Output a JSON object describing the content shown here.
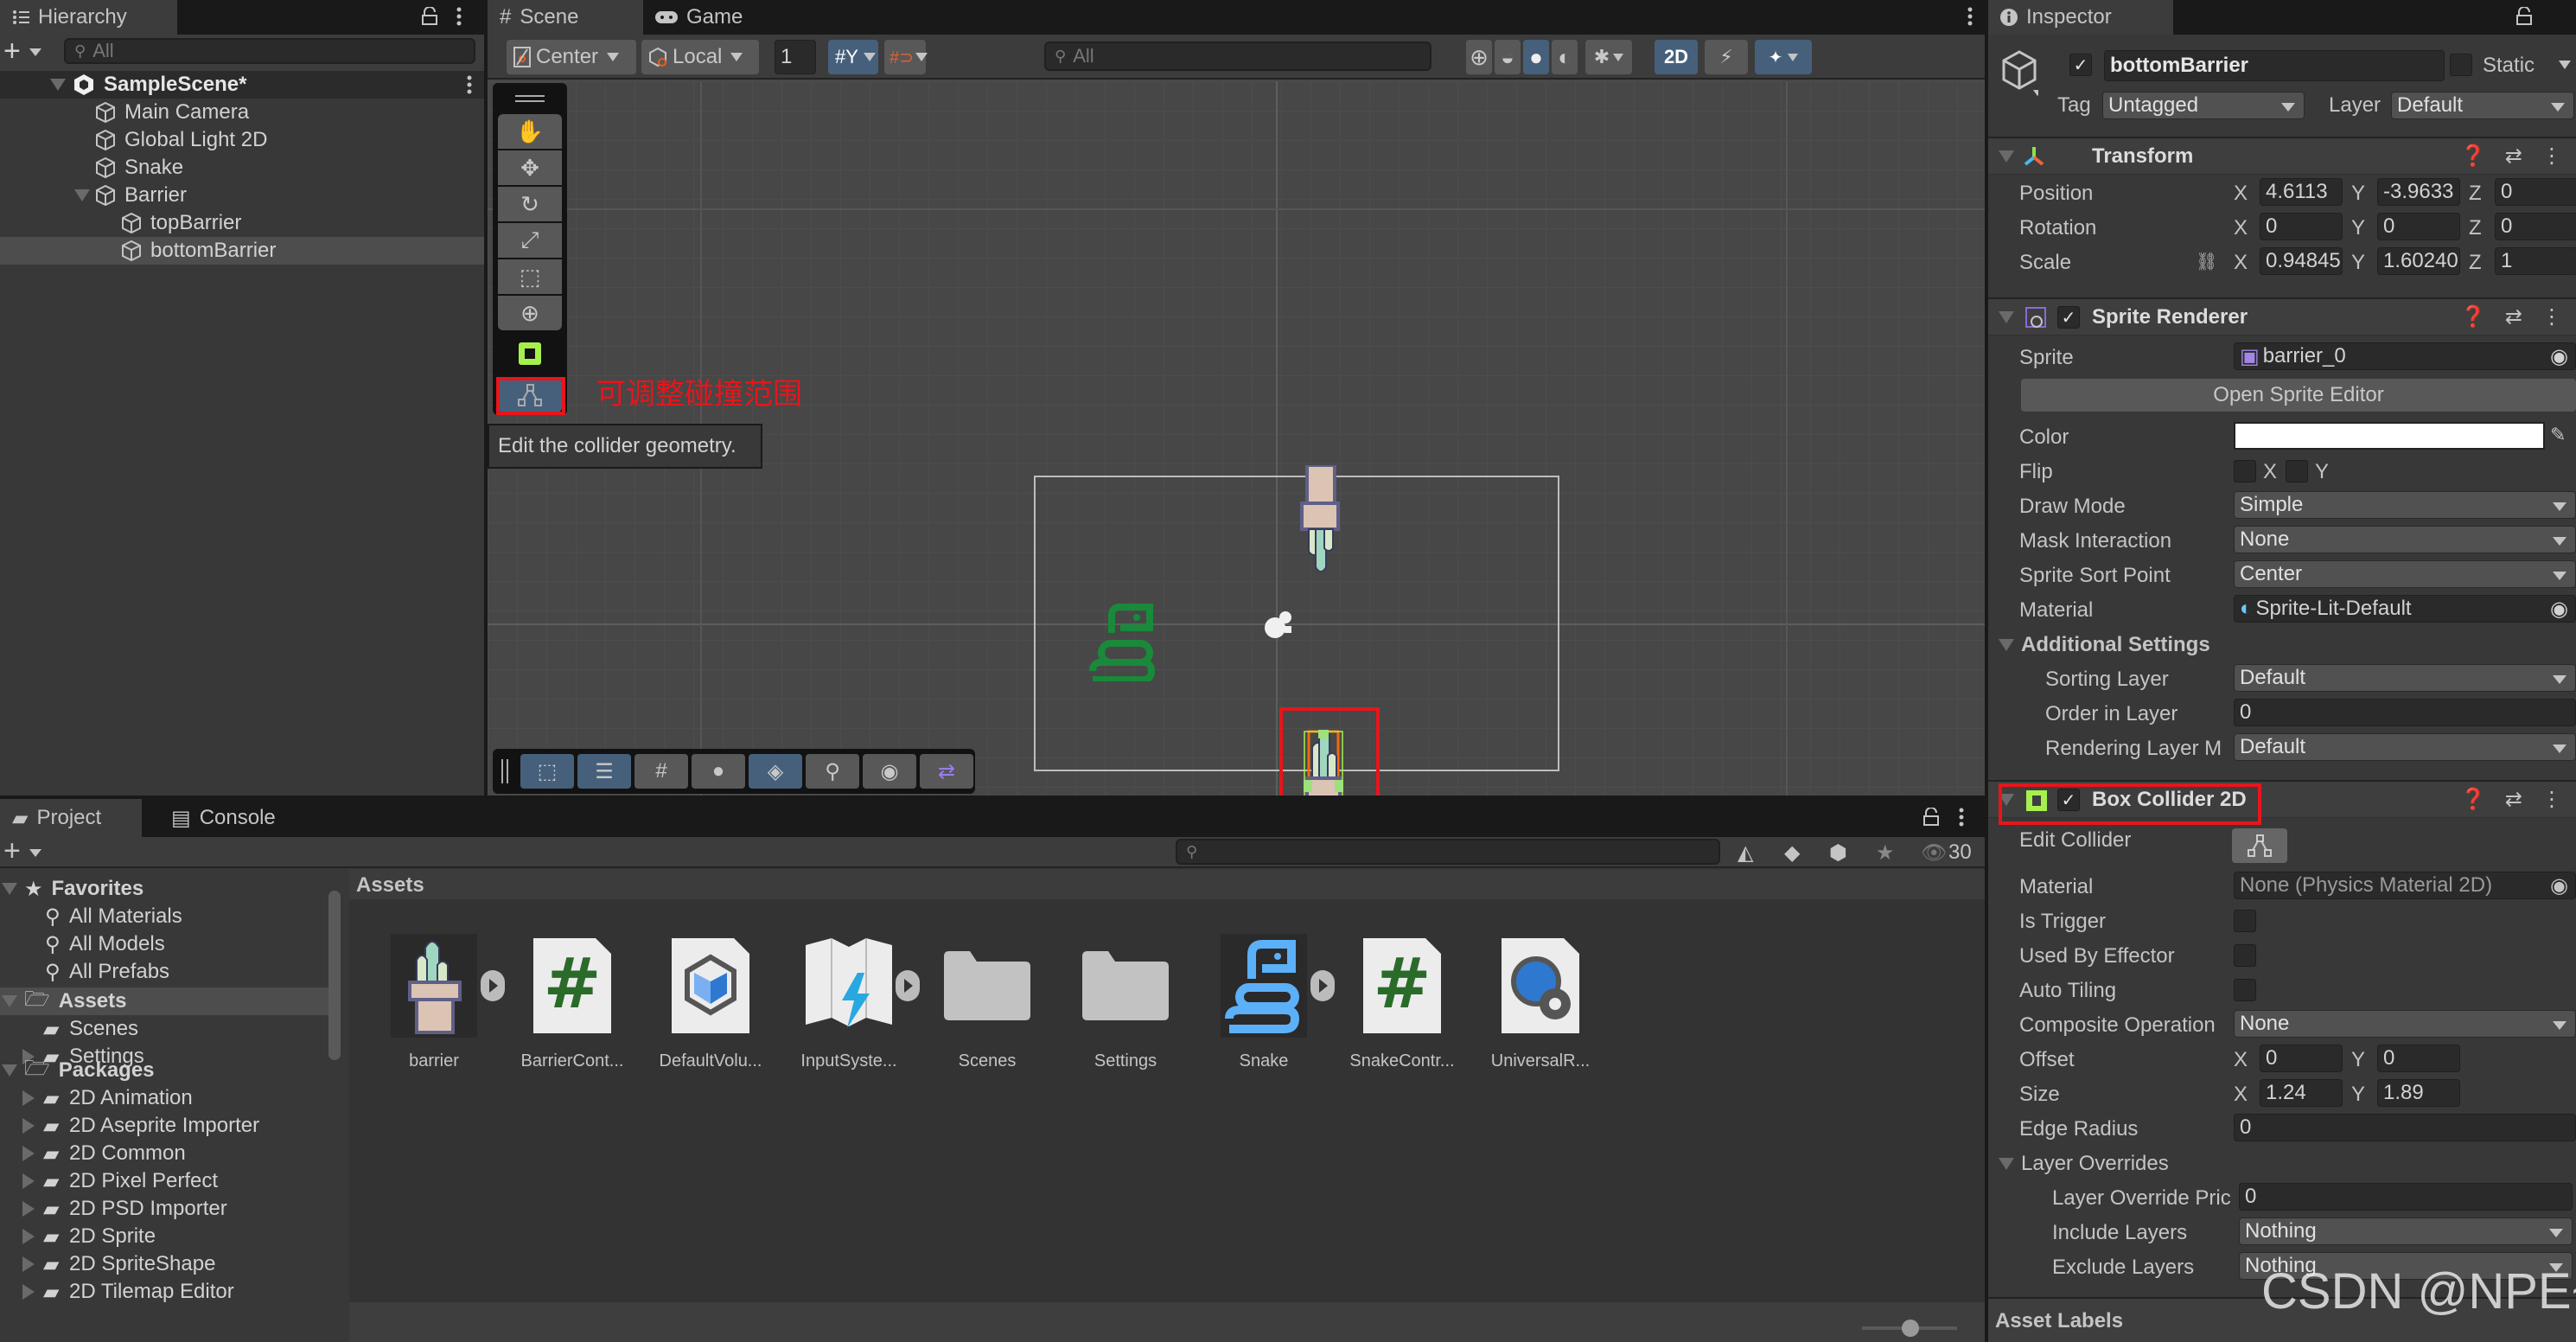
{
  "hierarchy": {
    "tab_label": "Hierarchy",
    "search_placeholder": "All",
    "scene_name": "SampleScene*",
    "items": [
      {
        "label": "Main Camera",
        "depth": 1
      },
      {
        "label": "Global Light 2D",
        "depth": 1
      },
      {
        "label": "Snake",
        "depth": 1
      },
      {
        "label": "Barrier",
        "depth": 1,
        "expanded": true
      },
      {
        "label": "topBarrier",
        "depth": 2
      },
      {
        "label": "bottomBarrier",
        "depth": 2,
        "selected": true
      }
    ]
  },
  "scene": {
    "tabs": [
      {
        "label": "Scene",
        "icon": "grid-icon",
        "active": true
      },
      {
        "label": "Game",
        "icon": "gamepad-icon",
        "active": false
      }
    ],
    "toolbar": {
      "pivot_label": "Center",
      "space_label": "Local",
      "grid_size_value": "1",
      "search_placeholder": "All",
      "mode_2d_label": "2D"
    },
    "tools": [
      "hand-tool",
      "move-tool",
      "rotate-tool",
      "scale-tool",
      "rect-tool",
      "transform-tool"
    ],
    "annotation_text": "可调整碰撞范围",
    "tooltip_text": "Edit the collider geometry.",
    "overlay_tools": [
      "rect-select",
      "adjust",
      "grid-snap",
      "sphere",
      "tile-palette",
      "search",
      "camera-view",
      "shuffle"
    ]
  },
  "inspector": {
    "tab_label": "Inspector",
    "object_name": "bottomBarrier",
    "active": true,
    "static_label": "Static",
    "static_checked": false,
    "tag_label": "Tag",
    "tag_value": "Untagged",
    "layer_label": "Layer",
    "layer_value": "Default",
    "transform": {
      "title": "Transform",
      "position": {
        "label": "Position",
        "x": "4.6113",
        "y": "-3.9633",
        "z": "0"
      },
      "rotation": {
        "label": "Rotation",
        "x": "0",
        "y": "0",
        "z": "0"
      },
      "scale": {
        "label": "Scale",
        "x": "0.94845",
        "y": "1.60240",
        "z": "1"
      }
    },
    "sprite_renderer": {
      "title": "Sprite Renderer",
      "enabled": true,
      "sprite_label": "Sprite",
      "sprite_value": "barrier_0",
      "open_editor_label": "Open Sprite Editor",
      "color_label": "Color",
      "color_value": "#ffffff",
      "flip_label": "Flip",
      "flip_x_label": "X",
      "flip_y_label": "Y",
      "draw_mode_label": "Draw Mode",
      "draw_mode_value": "Simple",
      "mask_label": "Mask Interaction",
      "mask_value": "None",
      "sort_point_label": "Sprite Sort Point",
      "sort_point_value": "Center",
      "material_label": "Material",
      "material_value": "Sprite-Lit-Default",
      "additional_label": "Additional Settings",
      "sorting_layer_label": "Sorting Layer",
      "sorting_layer_value": "Default",
      "order_label": "Order in Layer",
      "order_value": "0",
      "rendering_mask_label": "Rendering Layer M",
      "rendering_mask_value": "Default"
    },
    "box_collider": {
      "title": "Box Collider 2D",
      "enabled": true,
      "edit_collider_label": "Edit Collider",
      "material_label": "Material",
      "material_value": "None (Physics Material 2D)",
      "is_trigger_label": "Is Trigger",
      "effector_label": "Used By Effector",
      "auto_tiling_label": "Auto Tiling",
      "composite_label": "Composite Operation",
      "composite_value": "None",
      "offset_label": "Offset",
      "offset_x": "0",
      "offset_y": "0",
      "size_label": "Size",
      "size_x": "1.24",
      "size_y": "1.89",
      "edge_radius_label": "Edge Radius",
      "edge_radius_value": "0",
      "layer_overrides_label": "Layer Overrides",
      "override_priority_label": "Layer Override Pric",
      "override_priority_value": "0",
      "include_label": "Include Layers",
      "include_value": "Nothing",
      "exclude_label": "Exclude Layers",
      "exclude_value": "Nothing"
    },
    "asset_labels": "Asset Labels"
  },
  "project": {
    "tabs": [
      {
        "label": "Project",
        "active": true
      },
      {
        "label": "Console",
        "active": false
      }
    ],
    "hidden_count": "30",
    "favorites_label": "Favorites",
    "favorites": [
      "All Materials",
      "All Models",
      "All Prefabs"
    ],
    "assets_label": "Assets",
    "asset_folders": [
      "Scenes",
      "Settings"
    ],
    "packages_label": "Packages",
    "packages": [
      "2D Animation",
      "2D Aseprite Importer",
      "2D Common",
      "2D Pixel Perfect",
      "2D PSD Importer",
      "2D Sprite",
      "2D SpriteShape",
      "2D Tilemap Editor"
    ],
    "breadcrumb": "Assets",
    "grid_items": [
      {
        "name": "barrier",
        "type": "sprite"
      },
      {
        "name": "BarrierCont...",
        "type": "script"
      },
      {
        "name": "DefaultVolu...",
        "type": "volume"
      },
      {
        "name": "InputSyste...",
        "type": "input"
      },
      {
        "name": "Scenes",
        "type": "folder"
      },
      {
        "name": "Settings",
        "type": "folder"
      },
      {
        "name": "Snake",
        "type": "sprite-snake"
      },
      {
        "name": "SnakeContr...",
        "type": "script"
      },
      {
        "name": "UniversalR...",
        "type": "urp"
      }
    ],
    "zoom_slider": 0.55
  },
  "watermark": "CSDN @NPE~",
  "colors": {
    "accent_blue": "#46607c",
    "highlight_red": "#e8151b",
    "collider_green": "#a6f04e",
    "script_green": "#2a6b2a"
  }
}
